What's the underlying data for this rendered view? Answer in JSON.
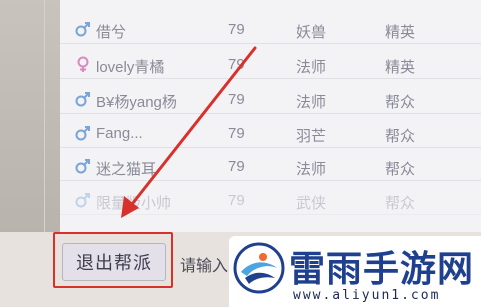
{
  "members": [
    {
      "gender": "male",
      "name": "借兮",
      "level": "79",
      "class": "妖兽",
      "position": "精英"
    },
    {
      "gender": "female",
      "name": "lovely青橘",
      "level": "79",
      "class": "法师",
      "position": "精英"
    },
    {
      "gender": "male",
      "name": "B¥杨yang杨",
      "level": "79",
      "class": "法师",
      "position": "帮众"
    },
    {
      "gender": "male",
      "name": "Fang...",
      "level": "79",
      "class": "羽芒",
      "position": "帮众"
    },
    {
      "gender": "male",
      "name": "迷之猫耳",
      "level": "79",
      "class": "法师",
      "position": "帮众"
    },
    {
      "gender": "male",
      "name": "限量版小帅",
      "level": "79",
      "class": "武侠",
      "position": "帮众"
    }
  ],
  "bottom_bar": {
    "exit_button_label": "退出帮派",
    "input_text": "请输入"
  },
  "watermark": {
    "name": "雷雨手游网",
    "url": "www.aliyun1.com"
  },
  "colors": {
    "annotation_red": "#d8312c",
    "male_icon": "#7aa3d6",
    "female_icon": "#d88ac2",
    "brand_blue": "#1f3f8f"
  }
}
